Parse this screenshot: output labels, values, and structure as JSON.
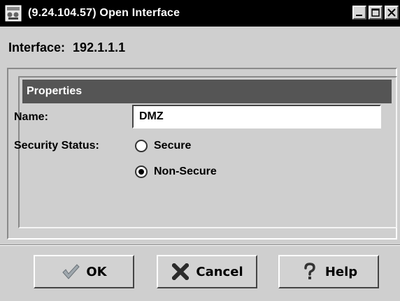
{
  "window": {
    "title": "(9.24.104.57) Open Interface",
    "controls": [
      "minimize",
      "maximize",
      "close"
    ]
  },
  "header": {
    "interface_label": "Interface:",
    "interface_value": "192.1.1.1"
  },
  "properties": {
    "section_title": "Properties",
    "name_label": "Name:",
    "name_value": "DMZ",
    "security_label": "Security Status:",
    "options": [
      {
        "label": "Secure",
        "selected": false
      },
      {
        "label": "Non-Secure",
        "selected": true
      }
    ]
  },
  "buttons": {
    "ok_label": "OK",
    "cancel_label": "Cancel",
    "help_label": "Help"
  },
  "icons": {
    "app": "app-window-icon",
    "ok": "checkmark-icon",
    "cancel": "x-icon",
    "help": "question-mark-icon"
  },
  "colors": {
    "titlebar": "#000000",
    "section_header": "#555555",
    "background": "#cfcfcf",
    "ok_icon": "#9aa2a8",
    "cancel_icon": "#2b2b2b"
  }
}
